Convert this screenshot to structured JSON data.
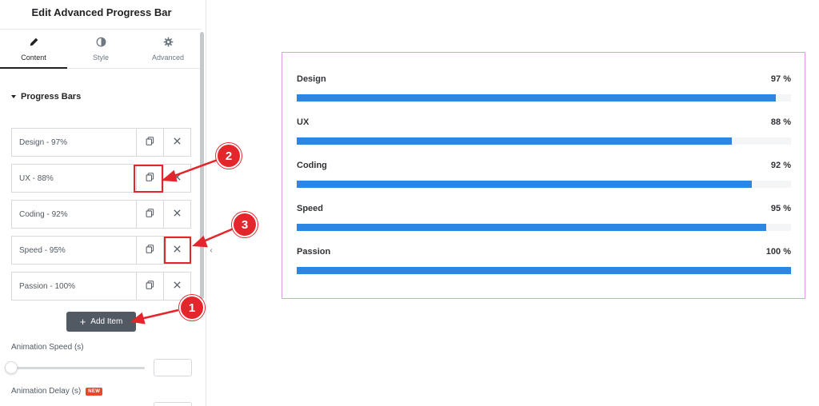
{
  "panel": {
    "title": "Edit Advanced Progress Bar",
    "tabs": [
      {
        "label": "Content",
        "icon": "pencil-icon"
      },
      {
        "label": "Style",
        "icon": "half-circle-icon"
      },
      {
        "label": "Advanced",
        "icon": "gear-icon"
      }
    ],
    "section_title": "Progress Bars",
    "items": [
      {
        "label": "Design - 97%"
      },
      {
        "label": "UX - 88%"
      },
      {
        "label": "Coding - 92%"
      },
      {
        "label": "Speed - 95%"
      },
      {
        "label": "Passion - 100%"
      }
    ],
    "add_item_label": "Add Item",
    "animation_speed_label": "Animation Speed (s)",
    "animation_delay_label": "Animation Delay (s)",
    "new_badge": "NEW"
  },
  "preview": {
    "bars": [
      {
        "label": "Design",
        "value_text": "97 %",
        "percent": 97
      },
      {
        "label": "UX",
        "value_text": "88 %",
        "percent": 88
      },
      {
        "label": "Coding",
        "value_text": "92 %",
        "percent": 92
      },
      {
        "label": "Speed",
        "value_text": "95 %",
        "percent": 95
      },
      {
        "label": "Passion",
        "value_text": "100 %",
        "percent": 100
      }
    ]
  },
  "annotations": {
    "callouts": [
      "1",
      "2",
      "3"
    ]
  },
  "colors": {
    "bar_fill": "#2b87e3",
    "annotation_red": "#e3252c",
    "preview_border": "#e29ae6"
  }
}
